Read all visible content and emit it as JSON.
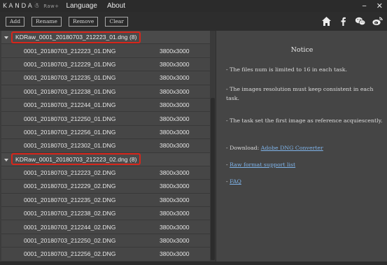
{
  "app": {
    "brand": "KANDA☃",
    "brand_sub": "Raw+",
    "menu": [
      "Language",
      "About"
    ],
    "window_controls": {
      "minimize": "−",
      "close": "✕"
    }
  },
  "toolbar": {
    "buttons": [
      "Add",
      "Rename",
      "Remove",
      "Clear"
    ],
    "social_icons": [
      "home-icon",
      "facebook-icon",
      "wechat-icon",
      "weibo-icon"
    ]
  },
  "groups": [
    {
      "label": "KDRaw_0001_20180703_212223_01.dng",
      "count": "(8)",
      "files": [
        {
          "name": "0001_20180703_212223_01.DNG",
          "res": "3800x3000"
        },
        {
          "name": "0001_20180703_212229_01.DNG",
          "res": "3800x3000"
        },
        {
          "name": "0001_20180703_212235_01.DNG",
          "res": "3800x3000"
        },
        {
          "name": "0001_20180703_212238_01.DNG",
          "res": "3800x3000"
        },
        {
          "name": "0001_20180703_212244_01.DNG",
          "res": "3800x3000"
        },
        {
          "name": "0001_20180703_212250_01.DNG",
          "res": "3800x3000"
        },
        {
          "name": "0001_20180703_212256_01.DNG",
          "res": "3800x3000"
        },
        {
          "name": "0001_20180703_212302_01.DNG",
          "res": "3800x3000"
        }
      ]
    },
    {
      "label": "KDRaw_0001_20180703_212223_02.dng",
      "count": "(8)",
      "files": [
        {
          "name": "0001_20180703_212223_02.DNG",
          "res": "3800x3000"
        },
        {
          "name": "0001_20180703_212229_02.DNG",
          "res": "3800x3000"
        },
        {
          "name": "0001_20180703_212235_02.DNG",
          "res": "3800x3000"
        },
        {
          "name": "0001_20180703_212238_02.DNG",
          "res": "3800x3000"
        },
        {
          "name": "0001_20180703_212244_02.DNG",
          "res": "3800x3000"
        },
        {
          "name": "0001_20180703_212250_02.DNG",
          "res": "3800x3000"
        },
        {
          "name": "0001_20180703_212256_02.DNG",
          "res": "3800x3000"
        }
      ]
    }
  ],
  "notice": {
    "title": "Notice",
    "line1": "- The files num is limited to 16 in each task.",
    "line2": "- The images resolution must keep consistent in each task.",
    "line3": "- The task set the first image as reference acquiescently.",
    "download_prefix": "- Download: ",
    "download_link": "Adobe DNG Converter",
    "raw_prefix": "- ",
    "raw_link": "Raw format support list",
    "faq_prefix": "- ",
    "faq_link": "FAQ"
  },
  "colors": {
    "highlight": "#d7261b",
    "link": "#7fb4ea"
  }
}
